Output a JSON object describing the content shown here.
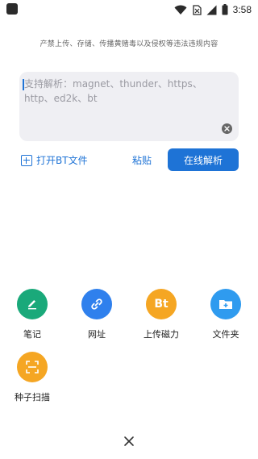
{
  "status_bar": {
    "time": "3:58",
    "icons": [
      "app-icon",
      "wifi-icon",
      "no-sim-icon",
      "signal-icon",
      "battery-icon"
    ]
  },
  "notice": "产禁上传、存储、传播黄赌毒以及侵权等违法违规内容",
  "input": {
    "placeholder": "支持解析：magnet、thunder、https、http、ed2k、bt",
    "value": ""
  },
  "actions": {
    "open_bt_label": "打开BT文件",
    "paste_label": "粘贴",
    "parse_label": "在线解析"
  },
  "tools": [
    {
      "label": "笔记",
      "icon": "pencil-icon",
      "color": "#1aa97a"
    },
    {
      "label": "网址",
      "icon": "link-icon",
      "color": "#2f80ed"
    },
    {
      "label": "上传磁力",
      "icon": "bt-icon",
      "icon_text": "Bt",
      "color": "#f5a623"
    },
    {
      "label": "文件夹",
      "icon": "folder-add-icon",
      "color": "#2f9bef"
    },
    {
      "label": "种子扫描",
      "icon": "scan-icon",
      "color": "#f5a623"
    }
  ],
  "colors": {
    "accent": "#1e73d6",
    "input_bg": "#efeff3"
  }
}
